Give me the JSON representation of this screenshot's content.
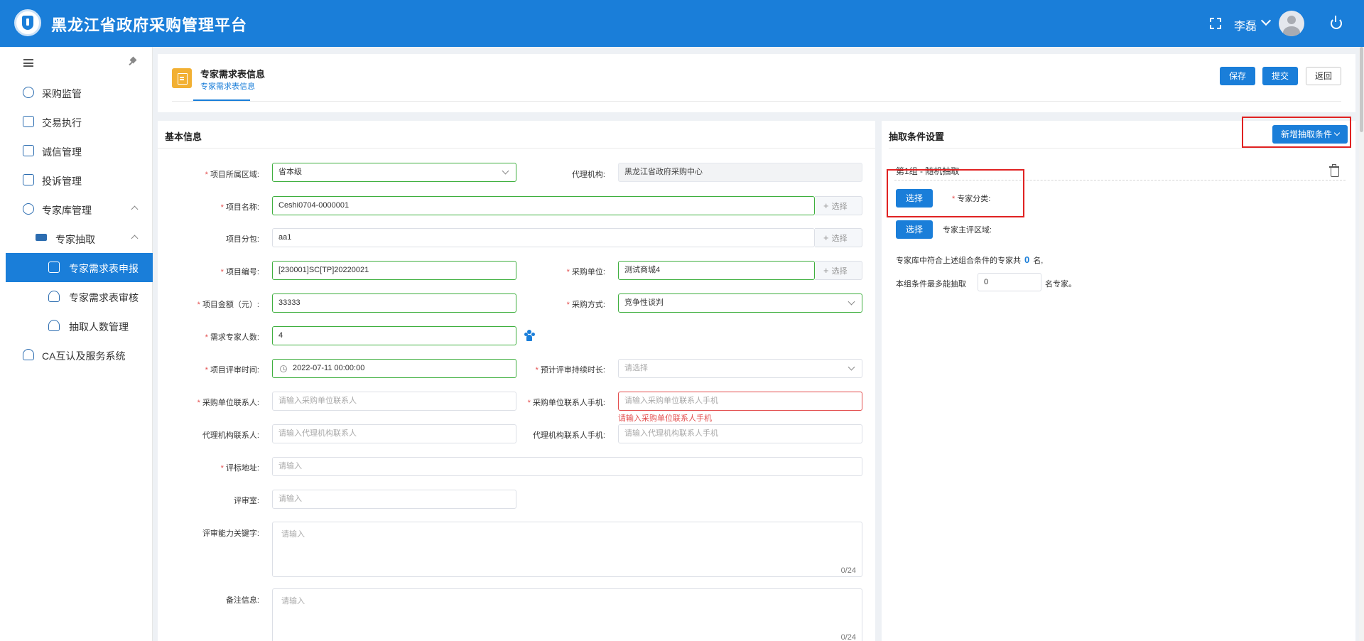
{
  "app": {
    "title": "黑龙江省政府采购管理平台",
    "user": "李磊"
  },
  "sidebar": {
    "items": [
      {
        "label": "采购监管"
      },
      {
        "label": "交易执行"
      },
      {
        "label": "诚信管理"
      },
      {
        "label": "投诉管理"
      },
      {
        "label": "专家库管理"
      },
      {
        "label": "专家抽取"
      },
      {
        "label": "专家需求表申报"
      },
      {
        "label": "专家需求表审核"
      },
      {
        "label": "抽取人数管理"
      },
      {
        "label": "CA互认及服务系统"
      }
    ]
  },
  "page": {
    "title": "专家需求表信息",
    "tab": "专家需求表信息",
    "buttons": {
      "save": "保存",
      "submit": "提交",
      "back": "返回"
    }
  },
  "basic": {
    "title": "基本信息",
    "region_label": "项目所属区域:",
    "region_value": "省本级",
    "agency_label": "代理机构:",
    "agency_value": "黑龙江省政府采购中心",
    "name_label": "项目名称:",
    "name_value": "Ceshi0704-0000001",
    "package_label": "项目分包:",
    "package_value": "aa1",
    "code_label": "项目编号:",
    "code_value": "[230001]SC[TP]20220021",
    "unit_label": "采购单位:",
    "unit_value": "测试商城4",
    "amount_label": "项目金额（元）:",
    "amount_value": "33333",
    "method_label": "采购方式:",
    "method_value": "竞争性谈判",
    "experts_label": "需求专家人数:",
    "experts_value": "4",
    "time_label": "项目评审时间:",
    "time_value": "2022-07-11 00:00:00",
    "duration_label": "预计评审持续时长:",
    "duration_placeholder": "请选择",
    "contact_label": "采购单位联系人:",
    "contact_placeholder": "请输入采购单位联系人",
    "phone_label": "采购单位联系人手机:",
    "phone_placeholder": "请输入采购单位联系人手机",
    "phone_error": "请输入采购单位联系人手机",
    "agency_contact_label": "代理机构联系人:",
    "agency_contact_placeholder": "请输入代理机构联系人",
    "agency_phone_label": "代理机构联系人手机:",
    "agency_phone_placeholder": "请输入代理机构联系人手机",
    "address_label": "评标地址:",
    "address_placeholder": "请输入",
    "room_label": "评审室:",
    "room_placeholder": "请输入",
    "keyword_label": "评审能力关键字:",
    "keyword_placeholder": "请输入",
    "keyword_counter": "0/24",
    "remark_label": "备注信息:",
    "remark_placeholder": "请输入",
    "remark_counter": "0/24",
    "select_btn": "选择"
  },
  "extract": {
    "title": "抽取条件设置",
    "add_btn": "新增抽取条件",
    "group_title": "第1组 - 随机抽取",
    "select_btn": "选择",
    "category_label": "专家分类:",
    "region_label": "专家主评区域:",
    "count_prefix": "专家库中符合上述组合条件的专家共",
    "count_value": "0",
    "count_suffix": "名,",
    "max_prefix": "本组条件最多能抽取",
    "max_value": "0",
    "max_suffix": "名专家。"
  },
  "colors": {
    "primary": "#1a7ed9",
    "success": "#3eaf3e",
    "error": "#e34d4d",
    "highlight": "#e02222"
  }
}
